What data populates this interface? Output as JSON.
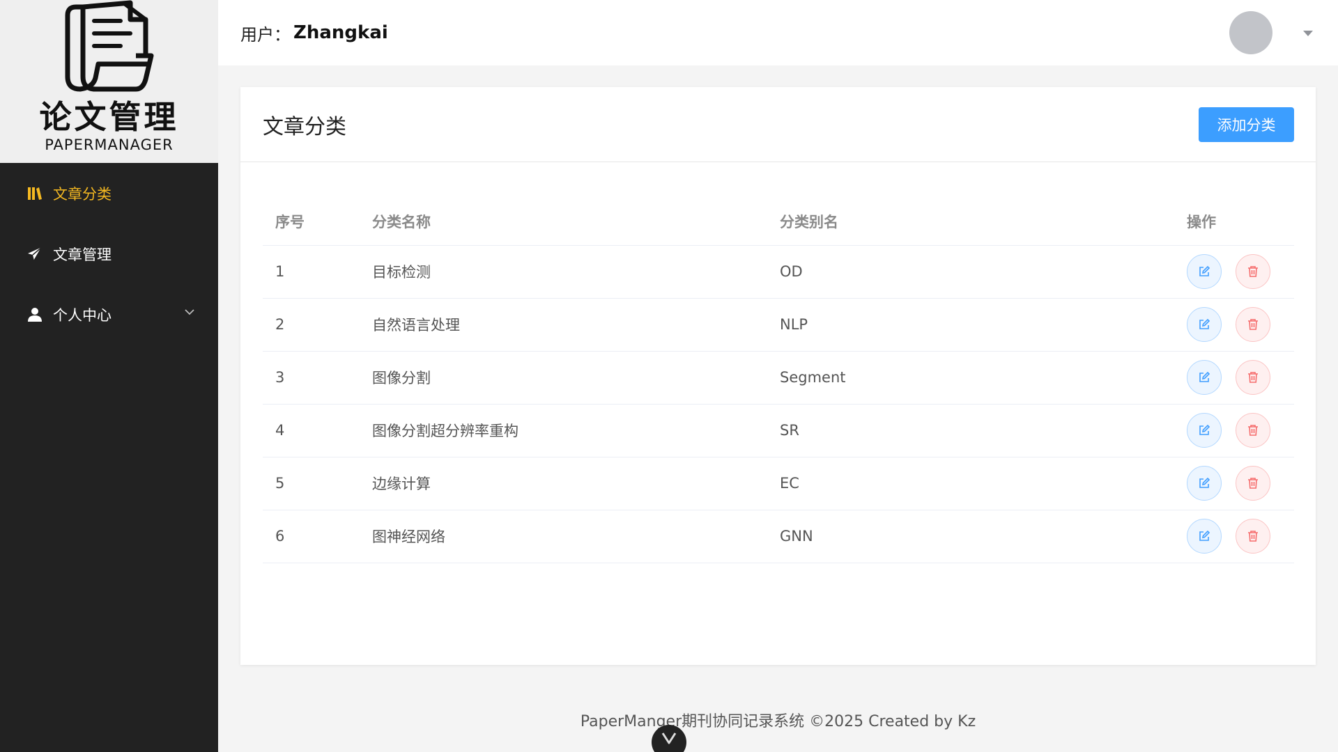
{
  "logo": {
    "title": "论文管理",
    "subtitle": "PAPERMANAGER"
  },
  "sidebar": {
    "items": [
      {
        "label": "文章分类",
        "icon": "book-icon",
        "active": true
      },
      {
        "label": "文章管理",
        "icon": "paper-plane-icon",
        "active": false
      },
      {
        "label": "个人中心",
        "icon": "user-icon",
        "active": false,
        "expandable": true
      }
    ]
  },
  "header": {
    "user_label": "用户：",
    "user_name": "Zhangkai"
  },
  "card": {
    "title": "文章分类",
    "add_button": "添加分类"
  },
  "table": {
    "headers": [
      "序号",
      "分类名称",
      "分类别名",
      "操作"
    ],
    "rows": [
      {
        "index": "1",
        "name": "目标检测",
        "alias": "OD"
      },
      {
        "index": "2",
        "name": "自然语言处理",
        "alias": "NLP"
      },
      {
        "index": "3",
        "name": "图像分割",
        "alias": "Segment"
      },
      {
        "index": "4",
        "name": "图像分割超分辨率重构",
        "alias": "SR"
      },
      {
        "index": "5",
        "name": "边缘计算",
        "alias": "EC"
      },
      {
        "index": "6",
        "name": "图神经网络",
        "alias": "GNN"
      }
    ]
  },
  "footer": {
    "text": "PaperManger期刊协同记录系统 ©2025 Created by Kz"
  },
  "colors": {
    "sidebar_bg": "#222222",
    "active": "#f5b921",
    "primary": "#3c9eff",
    "danger": "#f56c6c"
  }
}
